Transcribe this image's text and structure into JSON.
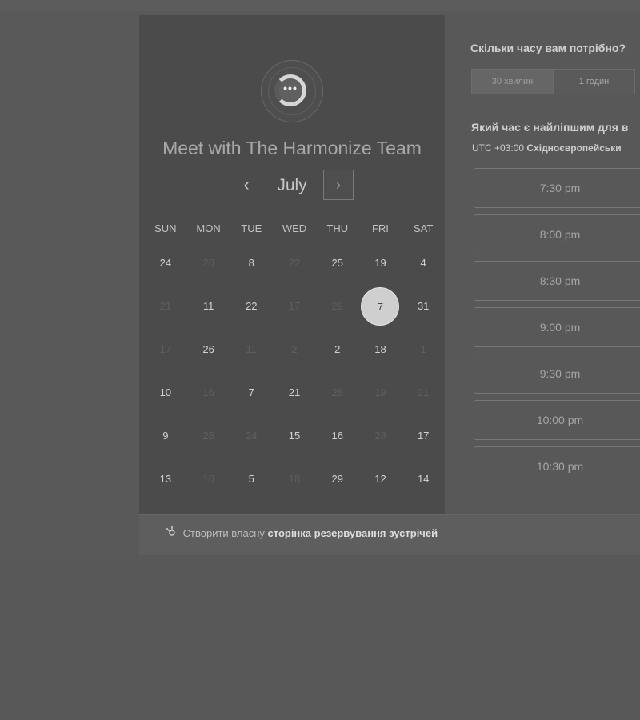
{
  "meeting": {
    "title": "Meet with The Harmonize Team",
    "avatar_icon": "chat-bubble-icon",
    "avatar_text": "•••"
  },
  "calendar": {
    "month": "July",
    "prev_symbol": "‹",
    "next_symbol": "›",
    "weekdays": [
      "SUN",
      "MON",
      "TUE",
      "WED",
      "THU",
      "FRI",
      "SAT"
    ],
    "weeks": [
      [
        {
          "d": "24",
          "a": true
        },
        {
          "d": "26",
          "a": false
        },
        {
          "d": "8",
          "a": true
        },
        {
          "d": "22",
          "a": false
        },
        {
          "d": "25",
          "a": true
        },
        {
          "d": "19",
          "a": true
        },
        {
          "d": "4",
          "a": true
        }
      ],
      [
        {
          "d": "21",
          "a": false
        },
        {
          "d": "11",
          "a": true
        },
        {
          "d": "22",
          "a": true
        },
        {
          "d": "17",
          "a": false
        },
        {
          "d": "29",
          "a": false
        },
        {
          "d": "7",
          "a": true,
          "selected": true
        },
        {
          "d": "31",
          "a": true
        }
      ],
      [
        {
          "d": "17",
          "a": false
        },
        {
          "d": "26",
          "a": true
        },
        {
          "d": "11",
          "a": false
        },
        {
          "d": "2",
          "a": false
        },
        {
          "d": "2",
          "a": true
        },
        {
          "d": "18",
          "a": true
        },
        {
          "d": "1",
          "a": false
        }
      ],
      [
        {
          "d": "10",
          "a": true
        },
        {
          "d": "16",
          "a": false
        },
        {
          "d": "7",
          "a": true
        },
        {
          "d": "21",
          "a": true
        },
        {
          "d": "28",
          "a": false
        },
        {
          "d": "19",
          "a": false
        },
        {
          "d": "21",
          "a": false
        }
      ],
      [
        {
          "d": "9",
          "a": true
        },
        {
          "d": "28",
          "a": false
        },
        {
          "d": "24",
          "a": false
        },
        {
          "d": "15",
          "a": true
        },
        {
          "d": "16",
          "a": true
        },
        {
          "d": "28",
          "a": false
        },
        {
          "d": "17",
          "a": true
        }
      ],
      [
        {
          "d": "13",
          "a": true
        },
        {
          "d": "16",
          "a": false
        },
        {
          "d": "5",
          "a": true
        },
        {
          "d": "18",
          "a": false
        },
        {
          "d": "29",
          "a": true
        },
        {
          "d": "12",
          "a": true
        },
        {
          "d": "14",
          "a": true
        }
      ]
    ]
  },
  "booking": {
    "duration_question": "Скільки часу вам потрібно?",
    "durations": [
      "30 хвилин",
      "1 годин"
    ],
    "selected_duration": "30 хвилин",
    "time_question": "Який час є найліпшим для в",
    "timezone_offset": "UTC +03:00",
    "timezone_name": "Східноєвропейськи",
    "slots": [
      "7:30 pm",
      "8:00 pm",
      "8:30 pm",
      "9:00 pm",
      "9:30 pm",
      "10:00 pm",
      "10:30 pm"
    ]
  },
  "footer": {
    "icon": "sprocket-icon",
    "prefix": "Створити власну",
    "link": "сторінка резервування зустрічей"
  }
}
